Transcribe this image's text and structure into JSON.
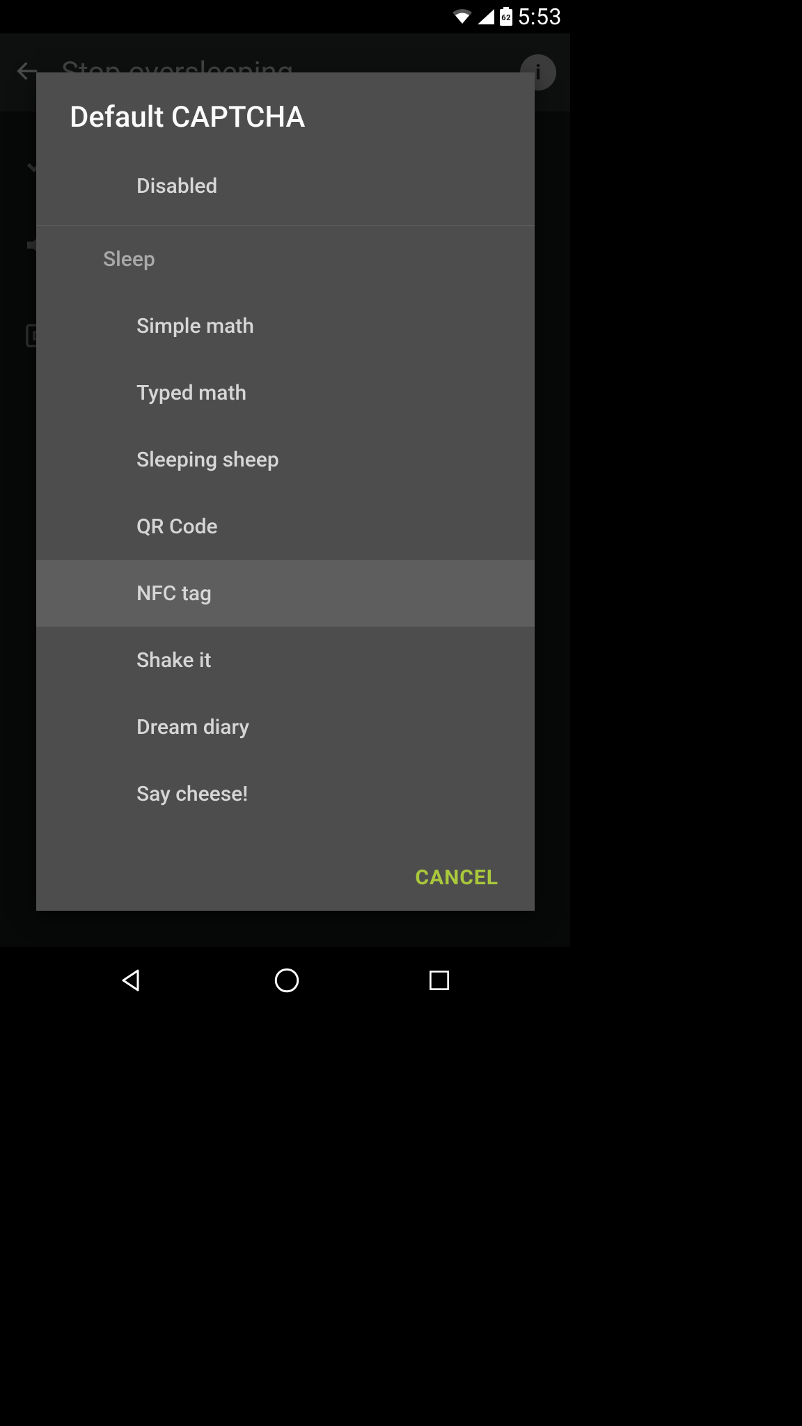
{
  "status": {
    "clock": "5:53",
    "battery_pct": "62"
  },
  "app": {
    "title": "Stop oversleeping"
  },
  "dialog": {
    "title": "Default CAPTCHA",
    "disabled_label": "Disabled",
    "section_label": "Sleep",
    "options": [
      "Simple math",
      "Typed math",
      "Sleeping sheep",
      "QR Code",
      "NFC tag",
      "Shake it",
      "Dream diary",
      "Say cheese!"
    ],
    "selected_index": 4,
    "cancel_label": "CANCEL"
  }
}
